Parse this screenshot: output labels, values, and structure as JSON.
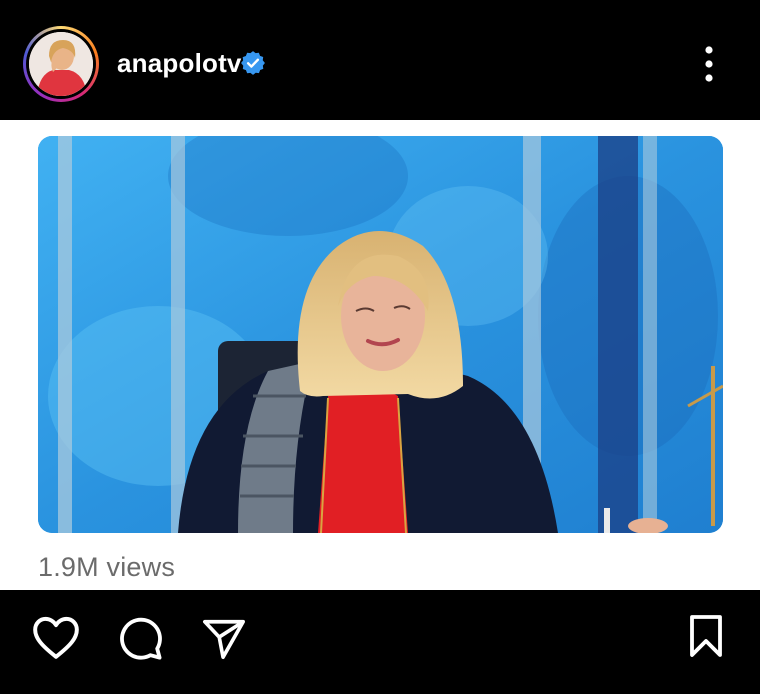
{
  "post": {
    "username": "anapolotv",
    "verified": true,
    "views": "1.9M views"
  },
  "icons": {
    "verified": "verified-badge-icon",
    "more": "more-vertical-icon",
    "like": "heart-icon",
    "comment": "comment-icon",
    "share": "send-icon",
    "save": "bookmark-icon"
  },
  "colors": {
    "verified_blue": "#3797f0",
    "background": "#000000",
    "post_background": "#ffffff",
    "views_text": "#6b6b6b"
  }
}
